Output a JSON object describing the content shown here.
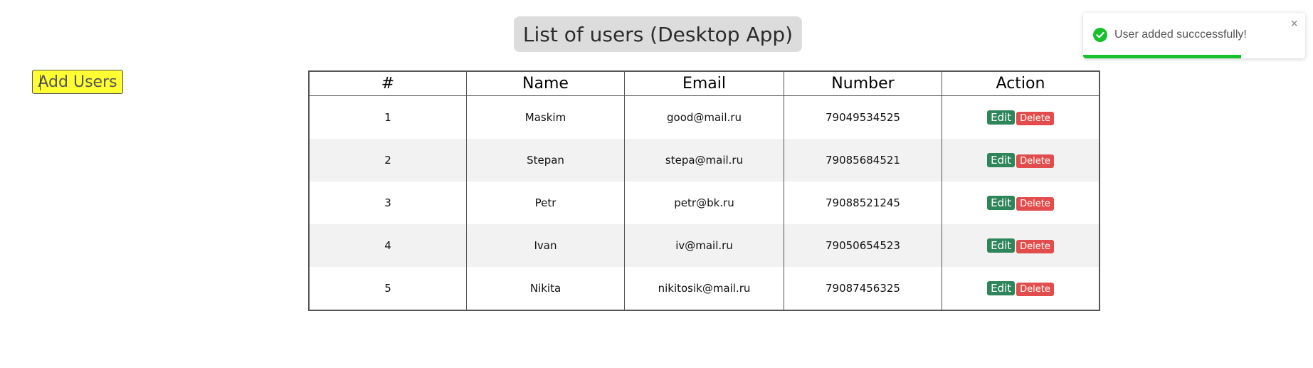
{
  "header": {
    "title": "List of users (Desktop App)"
  },
  "toolbar": {
    "add_label": "Add Users"
  },
  "table": {
    "columns": [
      "#",
      "Name",
      "Email",
      "Number",
      "Action"
    ],
    "edit_label": "Edit",
    "delete_label": "Delete",
    "rows": [
      {
        "id": "1",
        "name": "Maskim",
        "email": "good@mail.ru",
        "number": "79049534525"
      },
      {
        "id": "2",
        "name": "Stepan",
        "email": "stepa@mail.ru",
        "number": "79085684521"
      },
      {
        "id": "3",
        "name": "Petr",
        "email": "petr@bk.ru",
        "number": "79088521245"
      },
      {
        "id": "4",
        "name": "Ivan",
        "email": "iv@mail.ru",
        "number": "79050654523"
      },
      {
        "id": "5",
        "name": "Nikita",
        "email": "nikitosik@mail.ru",
        "number": "79087456325"
      }
    ]
  },
  "toast": {
    "message": "User added succcessfully!",
    "close_symbol": "×",
    "icon": "check-circle-icon",
    "progress": 0.71,
    "accent_color": "#16c12c"
  },
  "colors": {
    "edit": "#2f855a",
    "delete": "#e24c4c",
    "add_button": "#ffff33",
    "title_bg": "#dcdcdc"
  }
}
